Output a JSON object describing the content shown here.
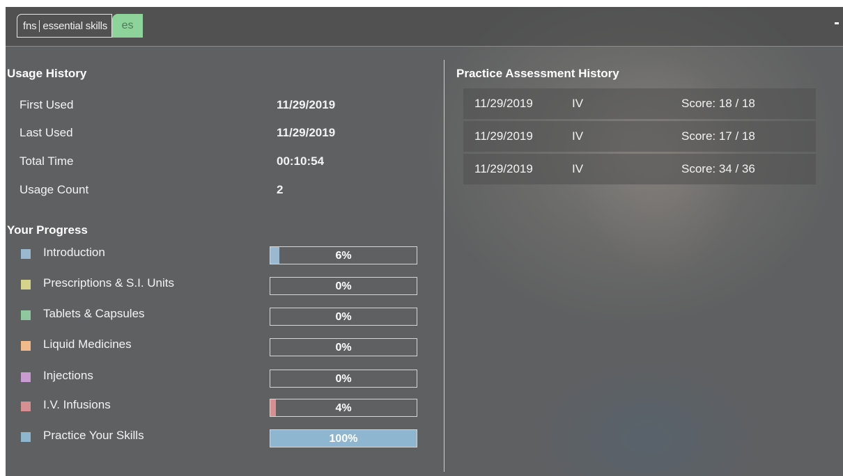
{
  "header": {
    "logo_fns": "fns",
    "logo_text": "essential skills",
    "logo_es": "es"
  },
  "usage": {
    "title": "Usage History",
    "rows": [
      {
        "label": "First Used",
        "value": "11/29/2019"
      },
      {
        "label": "Last Used",
        "value": "11/29/2019"
      },
      {
        "label": "Total Time",
        "value": "00:10:54"
      },
      {
        "label": "Usage Count",
        "value": "2"
      }
    ]
  },
  "progress": {
    "title": "Your Progress",
    "items": [
      {
        "label": "Introduction",
        "percent_text": "6%",
        "fraction": 0.06,
        "color": "#9ab8cf"
      },
      {
        "label": "Prescriptions & S.I. Units",
        "percent_text": "0%",
        "fraction": 0.0,
        "color": "#d6d38a"
      },
      {
        "label": "Tablets & Capsules",
        "percent_text": "0%",
        "fraction": 0.0,
        "color": "#8fc7a1"
      },
      {
        "label": "Liquid Medicines",
        "percent_text": "0%",
        "fraction": 0.0,
        "color": "#f2b98a"
      },
      {
        "label": "Injections",
        "percent_text": "0%",
        "fraction": 0.0,
        "color": "#c99bd0"
      },
      {
        "label": "I.V. Infusions",
        "percent_text": "4%",
        "fraction": 0.04,
        "color": "#d88f92"
      },
      {
        "label": "Practice Your Skills",
        "percent_text": "100%",
        "fraction": 1.0,
        "color": "#8fb6d1"
      }
    ]
  },
  "assessment": {
    "title": "Practice Assessment History",
    "rows": [
      {
        "date": "11/29/2019",
        "type": "IV",
        "score": "Score: 18 / 18"
      },
      {
        "date": "11/29/2019",
        "type": "IV",
        "score": "Score: 17 / 18"
      },
      {
        "date": "11/29/2019",
        "type": "IV",
        "score": "Score: 34 / 36"
      }
    ]
  }
}
